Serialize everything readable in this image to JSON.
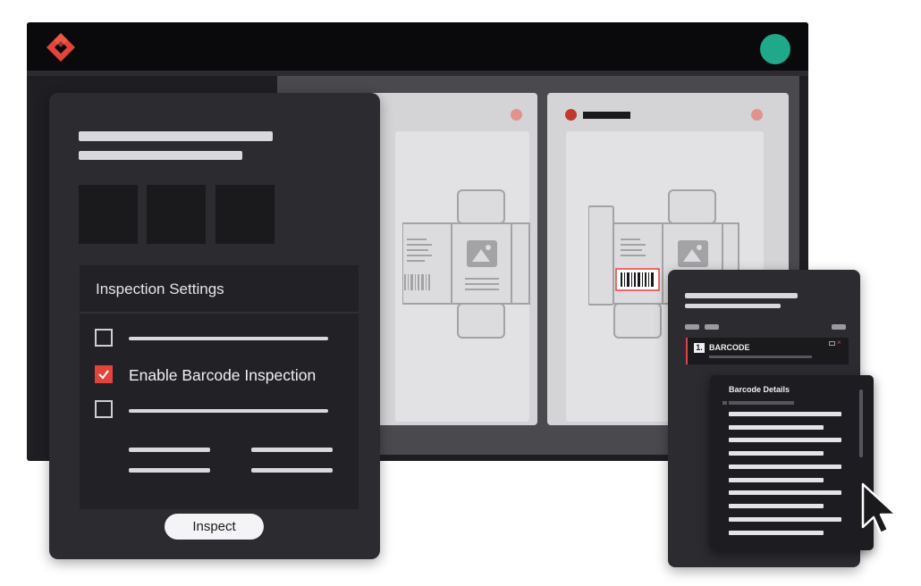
{
  "colors": {
    "accent": "#e0443a",
    "avatar": "#1fa88a",
    "dark": "#2b2b30"
  },
  "header": {
    "logo_icon": "diamond-logo-icon",
    "avatar_icon": "user-avatar-icon"
  },
  "settings": {
    "title": "Inspection Settings",
    "options": [
      {
        "label": "",
        "checked": false
      },
      {
        "label": "Enable Barcode Inspection",
        "checked": true
      },
      {
        "label": "",
        "checked": false
      }
    ],
    "inspect_label": "Inspect"
  },
  "barcode_panel": {
    "item_number": "1.",
    "item_label": "BARCODE",
    "details_title": "Barcode Details"
  }
}
